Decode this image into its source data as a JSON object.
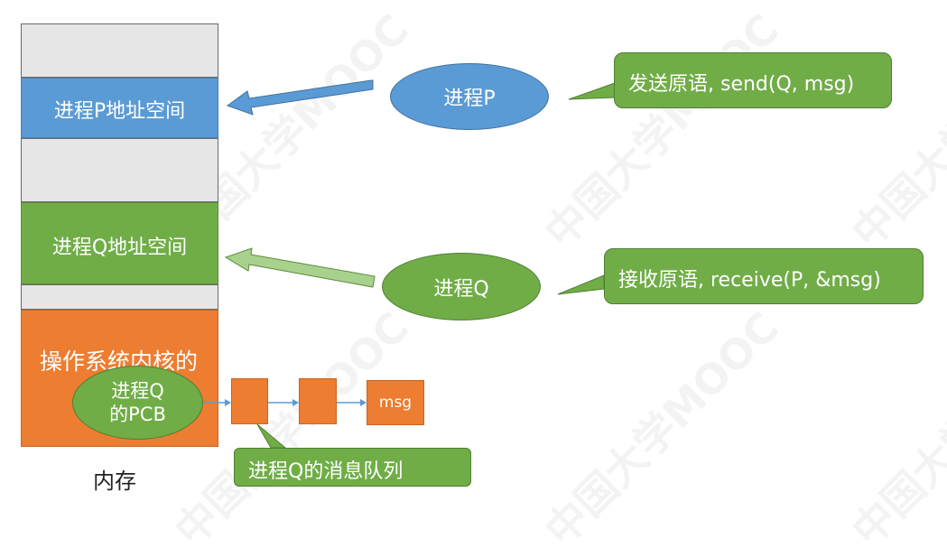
{
  "memory": {
    "caption": "内存",
    "p_space_label": "进程P地址空间",
    "q_space_label": "进程Q地址空间",
    "kernel_label": "操作系统内核的空间"
  },
  "process_p": {
    "label": "进程P"
  },
  "process_q": {
    "label": "进程Q"
  },
  "pcb": {
    "line1": "进程Q",
    "line2": "的PCB"
  },
  "callouts": {
    "send": "发送原语, send(Q, msg)",
    "receive": "接收原语, receive(P, &msg)",
    "queue": "进程Q的消息队列"
  },
  "queue": {
    "msg_label": "msg"
  },
  "watermark": {
    "text": "中国大学MOOC"
  },
  "colors": {
    "blue": "#5b9bd5",
    "green": "#70ad47",
    "orange": "#ed7d31",
    "gray": "#e7e6e6",
    "light_green": "#a9d18e"
  }
}
